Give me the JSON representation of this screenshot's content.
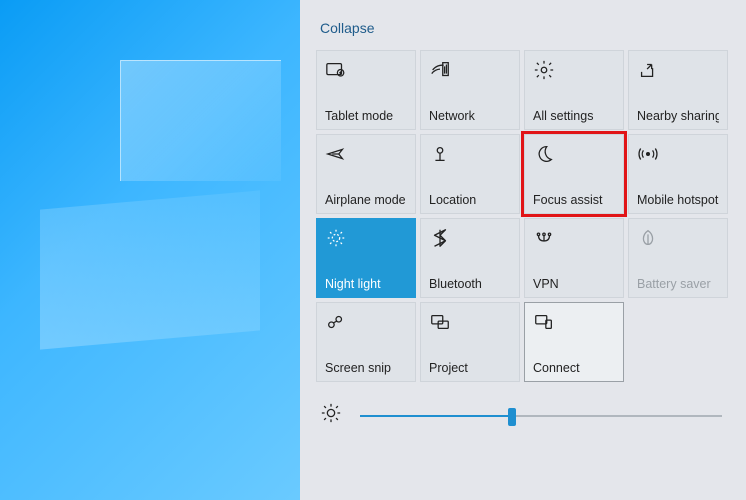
{
  "header": {
    "collapse_label": "Collapse"
  },
  "tiles": {
    "tablet": {
      "label": "Tablet mode"
    },
    "network": {
      "label": "Network"
    },
    "settings": {
      "label": "All settings"
    },
    "nearby": {
      "label": "Nearby sharing"
    },
    "airplane": {
      "label": "Airplane mode"
    },
    "location": {
      "label": "Location"
    },
    "focus": {
      "label": "Focus assist"
    },
    "hotspot": {
      "label": "Mobile hotspot"
    },
    "night": {
      "label": "Night light"
    },
    "bluetooth": {
      "label": "Bluetooth"
    },
    "vpn": {
      "label": "VPN"
    },
    "battery": {
      "label": "Battery saver"
    },
    "snip": {
      "label": "Screen snip"
    },
    "project": {
      "label": "Project"
    },
    "connect": {
      "label": "Connect"
    }
  },
  "brightness": {
    "value": 42,
    "min": 0,
    "max": 100
  },
  "state": {
    "active_tile": "night",
    "highlighted_tile": "focus",
    "selected_tile": "connect",
    "disabled_tiles": [
      "battery"
    ]
  },
  "colors": {
    "accent": "#2199d6",
    "panel_bg": "#e4e6eb",
    "highlight_outline": "#e11417",
    "desktop_blue": "#0a9cf5"
  }
}
